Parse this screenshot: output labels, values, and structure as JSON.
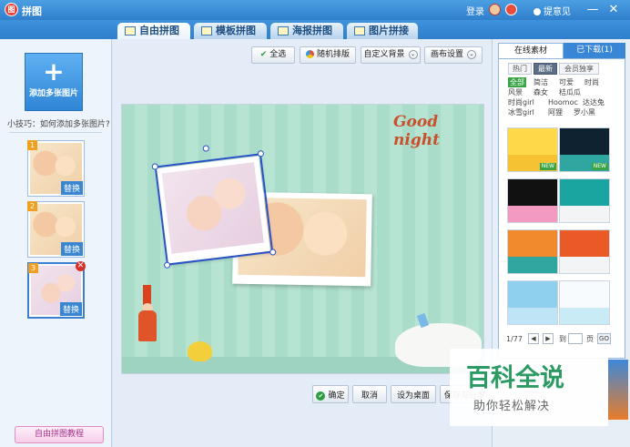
{
  "app": {
    "title": "拼图",
    "icon_text": "图",
    "login": "登录",
    "feedback": "提意见",
    "minimize": "—",
    "close": "✕"
  },
  "tabs": [
    {
      "label": "自由拼图",
      "active": true
    },
    {
      "label": "模板拼图",
      "active": false
    },
    {
      "label": "海报拼图",
      "active": false
    },
    {
      "label": "图片拼接",
      "active": false
    }
  ],
  "left_panel": {
    "add_button": "添加多张图片",
    "add_icon": "+",
    "tip": "小技巧：如何添加多张图片?",
    "thumbs": [
      {
        "num": "1",
        "replace": "替换"
      },
      {
        "num": "2",
        "replace": "替换"
      },
      {
        "num": "3",
        "replace": "替换",
        "delete": "✕"
      }
    ],
    "tutorial": "自由拼图教程"
  },
  "toolbar": {
    "select_all": "全选",
    "random_layout": "随机排版",
    "custom_background": "自定义背景",
    "canvas_settings": "画布设置",
    "dropdown_glyph": "⌄"
  },
  "canvas": {
    "text": "Good night",
    "colors": {
      "stripe_a": "#a9dcc9",
      "stripe_b": "#b6e3d2",
      "text": "#c9502a"
    }
  },
  "bottom_bar": {
    "confirm": "确定",
    "cancel": "取消",
    "set_desktop": "设为桌面",
    "save_share": "保存与分享"
  },
  "right_panel": {
    "tab_online": "在线素材",
    "tab_downloaded": "已下载(1)",
    "subtabs": [
      {
        "label": "热门",
        "on": false
      },
      {
        "label": "最新",
        "on": true
      },
      {
        "label": "会员独享",
        "on": false
      }
    ],
    "tags": [
      [
        "全部",
        "简洁",
        "可爱",
        "时尚"
      ],
      [
        "风景",
        "森女",
        "桔瓜瓜"
      ],
      [
        "时尚girl",
        "Hoomoc",
        "达达兔"
      ],
      [
        "冰雪girl",
        "阿狸",
        "罗小黑"
      ]
    ],
    "pager": {
      "page": "1/77",
      "prev": "◀",
      "next": "▶",
      "goto_label": "到",
      "page_unit": "页",
      "go": "GO"
    },
    "new_badge": "NEW"
  },
  "watermark": {
    "title": "百科全说",
    "subtitle": "助你轻松解决"
  }
}
